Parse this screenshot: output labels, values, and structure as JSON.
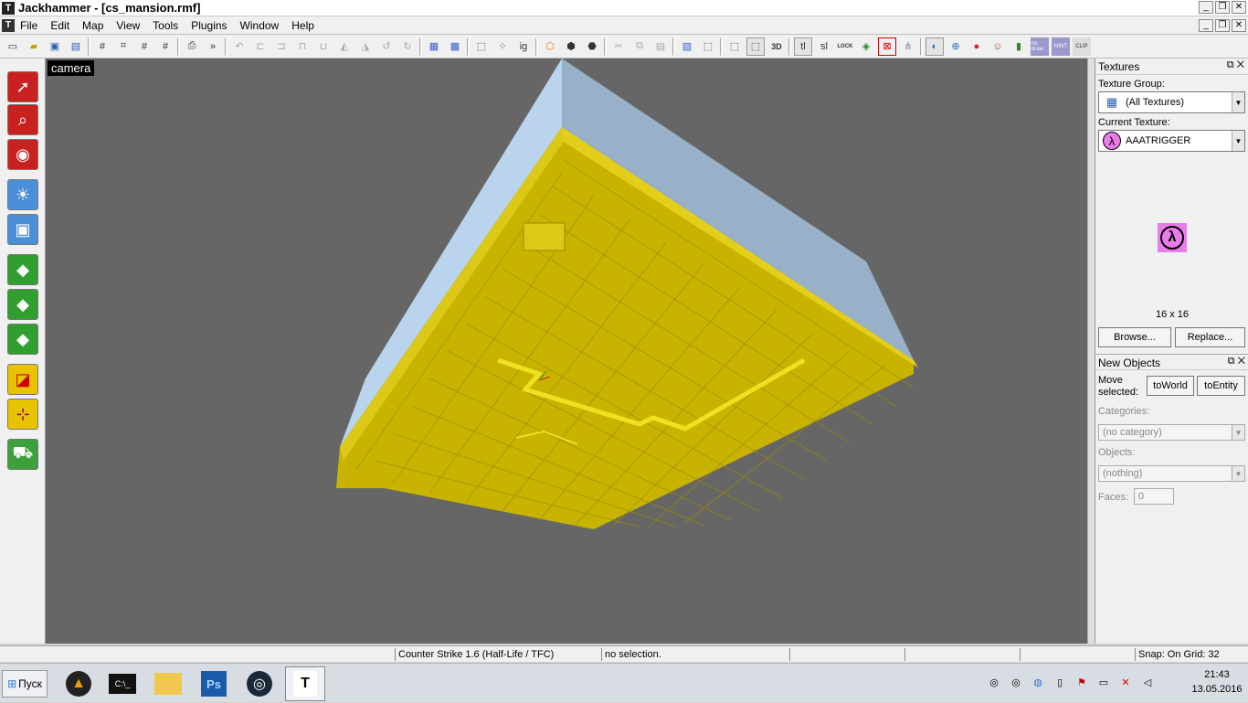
{
  "window": {
    "title": "Jackhammer - [cs_mansion.rmf]",
    "app_icon": "jackhammer-icon",
    "controls": [
      "minimize",
      "restore",
      "close"
    ]
  },
  "menu": {
    "items": [
      "File",
      "Edit",
      "Map",
      "View",
      "Tools",
      "Plugins",
      "Window",
      "Help"
    ]
  },
  "toolbar": {
    "overflow": "»",
    "text_buttons": [
      "ig",
      "tl",
      "sl"
    ],
    "extra_labels": [
      "LOCK",
      "no draw",
      "HINT",
      "CLIP"
    ]
  },
  "viewport": {
    "label": "camera",
    "background": "#666666",
    "brush_color": "#c8b400",
    "sky_color": "#9cb8d4"
  },
  "textures_panel": {
    "title": "Textures",
    "group_label": "Texture Group:",
    "group_value": "(All Textures)",
    "current_label": "Current Texture:",
    "current_value": "AAATRIGGER",
    "preview_size": "16 x 16",
    "browse": "Browse...",
    "replace": "Replace..."
  },
  "objects_panel": {
    "title": "New Objects",
    "move_label": "Move selected:",
    "to_world": "toWorld",
    "to_entity": "toEntity",
    "categories_label": "Categories:",
    "categories_value": "(no category)",
    "objects_label": "Objects:",
    "objects_value": "(nothing)",
    "faces_label": "Faces:",
    "faces_value": "0"
  },
  "status": {
    "game": "Counter Strike 1.6 (Half-Life / TFC)",
    "selection": "no selection.",
    "snap": "Snap: On Grid: 32"
  },
  "taskbar": {
    "start": "Пуск",
    "time": "21:43",
    "date": "13.05.2016"
  }
}
